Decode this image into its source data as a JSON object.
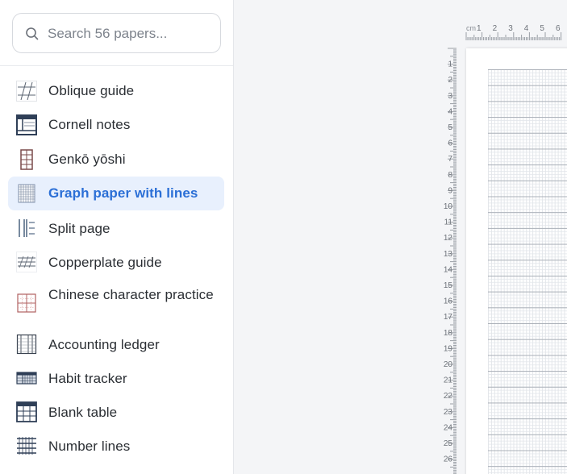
{
  "search": {
    "placeholder": "Search 56 papers..."
  },
  "papers": [
    {
      "label": "Oblique guide",
      "icon": "oblique-guide-icon",
      "active": false
    },
    {
      "label": "Cornell notes",
      "icon": "cornell-notes-icon",
      "active": false
    },
    {
      "label": "Genkō yōshi",
      "icon": "genko-yoshi-icon",
      "active": false
    },
    {
      "label": "Graph paper with lines",
      "icon": "graph-paper-icon",
      "active": true
    },
    {
      "label": "Split page",
      "icon": "split-page-icon",
      "active": false
    },
    {
      "label": "Copperplate guide",
      "icon": "copperplate-guide-icon",
      "active": false
    },
    {
      "label": "Chinese character practice",
      "icon": "chinese-character-practice-icon",
      "active": false
    },
    {
      "label": "Accounting ledger",
      "icon": "accounting-ledger-icon",
      "active": false
    },
    {
      "label": "Habit tracker",
      "icon": "habit-tracker-icon",
      "active": false
    },
    {
      "label": "Blank table",
      "icon": "blank-table-icon",
      "active": false
    },
    {
      "label": "Number lines",
      "icon": "number-lines-icon",
      "active": false
    }
  ],
  "ruler": {
    "unit": "cm",
    "top_labels": [
      "1",
      "2",
      "3",
      "4",
      "5",
      "6"
    ],
    "left_labels": [
      "1",
      "2",
      "3",
      "4",
      "5",
      "6",
      "7",
      "8",
      "9",
      "10",
      "11",
      "12",
      "13",
      "14",
      "15",
      "16",
      "17",
      "18",
      "19",
      "20",
      "21",
      "22",
      "23",
      "24",
      "25",
      "26"
    ]
  }
}
